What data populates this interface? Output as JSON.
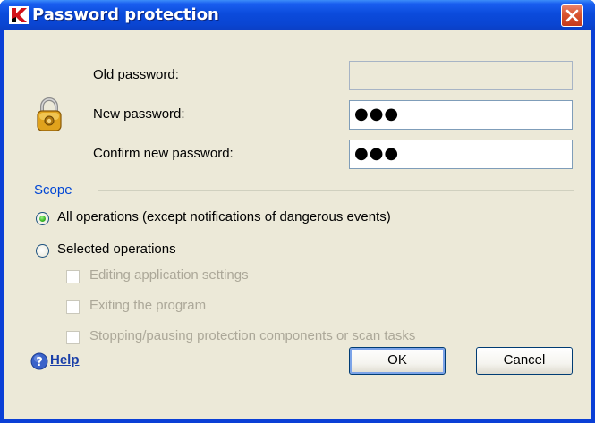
{
  "window": {
    "title": "Password protection",
    "app_logo_letter": "K"
  },
  "fields": {
    "old_password": {
      "label": "Old password:",
      "value": ""
    },
    "new_password": {
      "label": "New password:",
      "value": "●●●"
    },
    "confirm_password": {
      "label": "Confirm new password:",
      "value": "●●●"
    }
  },
  "scope": {
    "title": "Scope",
    "options": [
      {
        "label": "All operations (except notifications of dangerous events)",
        "selected": true,
        "mnemonic": "A"
      },
      {
        "label": "Selected operations",
        "selected": false,
        "mnemonic": "S"
      }
    ],
    "sub_options": [
      {
        "label": "Editing application settings",
        "checked": false,
        "enabled": false,
        "mnemonic": "E"
      },
      {
        "label": "Exiting the program",
        "checked": false,
        "enabled": false,
        "mnemonic": "E"
      },
      {
        "label": "Stopping/pausing protection components or scan tasks",
        "checked": false,
        "enabled": false,
        "mnemonic": "S"
      }
    ]
  },
  "footer": {
    "help_label": "Help",
    "ok_label": "OK",
    "cancel_label": "Cancel"
  },
  "colors": {
    "title_bar": "#0a45d2",
    "dialog_bg": "#ece9d8",
    "group_title": "#0046d5",
    "link": "#1a3fa8",
    "disabled_text": "#aca899",
    "close_button": "#d9542f"
  }
}
